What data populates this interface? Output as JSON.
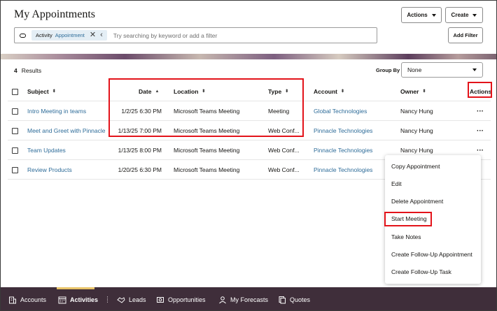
{
  "header": {
    "title": "My Appointments",
    "actions_label": "Actions",
    "create_label": "Create"
  },
  "search": {
    "chip_key": "Activity",
    "chip_value": "Appointment",
    "placeholder": "Try searching by keyword or add a filter",
    "add_filter_label": "Add Filter"
  },
  "results": {
    "count": "4",
    "label": "Results",
    "group_by_label": "Group By",
    "group_by_value": "None"
  },
  "table": {
    "columns": {
      "subject": "Subject",
      "date": "Date",
      "location": "Location",
      "type": "Type",
      "account": "Account",
      "owner": "Owner",
      "actions": "Actions"
    },
    "rows": [
      {
        "subject": "Intro Meeting in teams",
        "date": "1/2/25 6:30 PM",
        "location": "Microsoft Teams Meeting",
        "type": "Meeting",
        "account": "Global Technologies",
        "owner": "Nancy Hung"
      },
      {
        "subject": "Meet and Greet with Pinnacle",
        "date": "1/13/25 7:00 PM",
        "location": "Microsoft Teams Meeting",
        "type": "Web Conf...",
        "account": "Pinnacle Technologies",
        "owner": "Nancy Hung"
      },
      {
        "subject": "Team Updates",
        "date": "1/13/25 8:00 PM",
        "location": "Microsoft Teams Meeting",
        "type": "Web Conf...",
        "account": "Pinnacle Technologies",
        "owner": "Nancy Hung"
      },
      {
        "subject": "Review Products",
        "date": "1/20/25 6:30 PM",
        "location": "Microsoft Teams Meeting",
        "type": "Web Conf...",
        "account": "Pinnacle Technologies",
        "owner": ""
      }
    ],
    "row_actions": "···"
  },
  "menu": {
    "items": [
      "Copy Appointment",
      "Edit",
      "Delete Appointment",
      "Start Meeting",
      "Take Notes",
      "Create Follow-Up Appointment",
      "Create Follow-Up Task"
    ]
  },
  "bottom_nav": {
    "items": [
      "Accounts",
      "Activities",
      "Leads",
      "Opportunities",
      "My Forecasts",
      "Quotes"
    ]
  },
  "colors": {
    "link": "#2e6c99",
    "highlight": "#e3131a",
    "nav_bg": "#3f2e3a",
    "nav_active": "#e9c46a"
  }
}
